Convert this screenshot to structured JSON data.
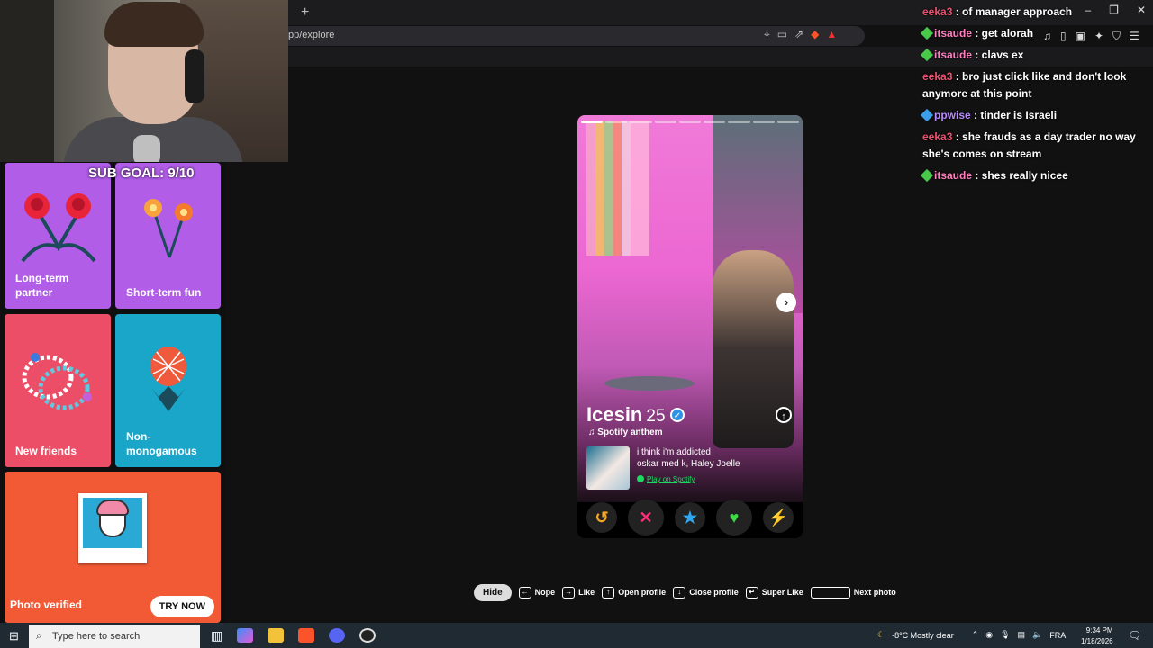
{
  "browser": {
    "url": "pp/explore",
    "new_tab_glyph": "+"
  },
  "overlay": {
    "sub_goal": "SUB GOAL: 9/10"
  },
  "cards": [
    {
      "label": "Long-term partner",
      "color": "#b15de8",
      "icon": "roses-icon"
    },
    {
      "label": "Short-term fun",
      "color": "#b15de8",
      "icon": "sparklers-icon"
    },
    {
      "label": "New friends",
      "color": "#ed4e67",
      "icon": "bracelets-icon"
    },
    {
      "label": "Non-monogamous",
      "color": "#1aa6c9",
      "icon": "pineapple-icon"
    },
    {
      "label": "Photo verified",
      "color": "#f25a36",
      "icon": "polaroid-face-icon",
      "button": "TRY NOW"
    }
  ],
  "profile": {
    "name": "Icesin",
    "age": "25",
    "verified": true,
    "section_label": "Spotify anthem",
    "song_title": "i think i'm addicted",
    "song_artist": "oskar med k, Haley Joelle",
    "spotify_link": "Play on Spotify",
    "photo_index": 1,
    "photo_count": 9
  },
  "actions": [
    {
      "name": "rewind",
      "glyph": "↺",
      "color": "#f5a623"
    },
    {
      "name": "nope",
      "glyph": "✕",
      "color": "#ff2e7a"
    },
    {
      "name": "super-like",
      "glyph": "★",
      "color": "#2fa8f0"
    },
    {
      "name": "like",
      "glyph": "♥",
      "color": "#3fd94a"
    },
    {
      "name": "boost",
      "glyph": "⚡",
      "color": "#b245f0"
    }
  ],
  "hints": {
    "hide": "Hide",
    "nope": "Nope",
    "like": "Like",
    "open_profile": "Open profile",
    "close_profile": "Close profile",
    "super_like": "Super Like",
    "next_photo": "Next photo"
  },
  "chat": [
    {
      "user": "eeka3",
      "color": "#f0506e",
      "badge": "",
      "text": ": of manager approach"
    },
    {
      "user": "itsaude",
      "color": "#ff7fbf",
      "badge": "green",
      "text": ": get alorah"
    },
    {
      "user": "itsaude",
      "color": "#ff7fbf",
      "badge": "green",
      "text": ": clavs ex"
    },
    {
      "user": "eeka3",
      "color": "#f0506e",
      "badge": "",
      "text": ": bro just click like and don't look anymore at this point"
    },
    {
      "user": "ppwise",
      "color": "#b88bff",
      "badge": "blue",
      "text": ": tinder is Israeli"
    },
    {
      "user": "eeka3",
      "color": "#f0506e",
      "badge": "",
      "text": ": she frauds as a day trader no way she's comes on stream"
    },
    {
      "user": "itsaude",
      "color": "#ff7fbf",
      "badge": "green",
      "text": ": shes really nicee"
    }
  ],
  "taskbar": {
    "search_placeholder": "Type here to search",
    "weather": "-8°C  Mostly clear",
    "lang": "FRA",
    "time": "9:34 PM",
    "date": "1/18/2026"
  }
}
